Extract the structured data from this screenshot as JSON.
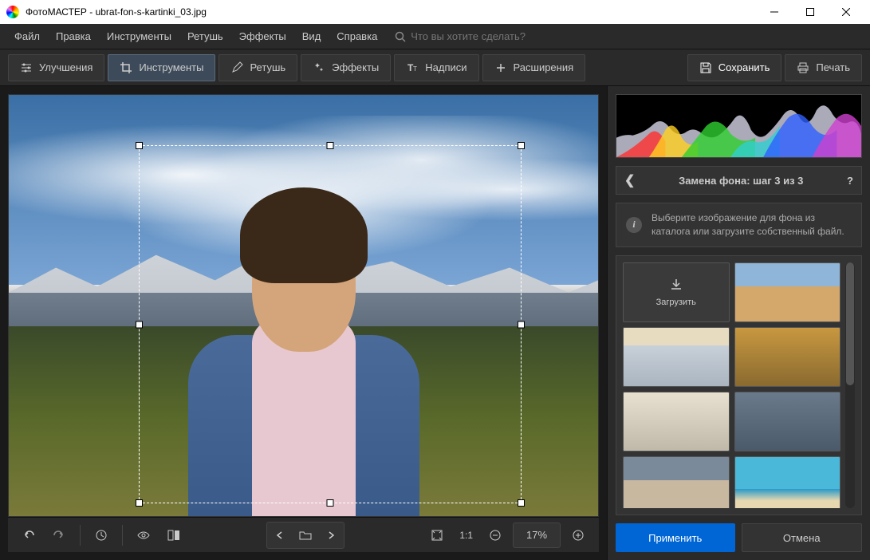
{
  "titlebar": {
    "app_name": "ФотоМАСТЕР",
    "file_name": "ubrat-fon-s-kartinki_03.jpg",
    "full_title": "ФотоМАСТЕР - ubrat-fon-s-kartinki_03.jpg"
  },
  "menubar": {
    "items": [
      "Файл",
      "Правка",
      "Инструменты",
      "Ретушь",
      "Эффекты",
      "Вид",
      "Справка"
    ],
    "search_placeholder": "Что вы хотите сделать?"
  },
  "toolbar": {
    "tabs": [
      {
        "label": "Улучшения",
        "icon": "sliders-icon",
        "active": false
      },
      {
        "label": "Инструменты",
        "icon": "crop-icon",
        "active": true
      },
      {
        "label": "Ретушь",
        "icon": "brush-icon",
        "active": false
      },
      {
        "label": "Эффекты",
        "icon": "wand-icon",
        "active": false
      },
      {
        "label": "Надписи",
        "icon": "text-icon",
        "active": false
      },
      {
        "label": "Расширения",
        "icon": "plus-icon",
        "active": false
      }
    ],
    "save_label": "Сохранить",
    "print_label": "Печать"
  },
  "bottombar": {
    "zoom_value": "17%",
    "ratio_label": "1:1"
  },
  "right_panel": {
    "header_title": "Замена фона: шаг 3 из 3",
    "info_text": "Выберите изображение для фона из каталога или загрузите собственный файл.",
    "upload_label": "Загрузить",
    "backgrounds": [
      {
        "name": "upload",
        "type": "upload"
      },
      {
        "name": "desert",
        "colors": [
          "#d4a76a",
          "#8fb5d8"
        ]
      },
      {
        "name": "winter-road",
        "colors": [
          "#c8d0d8",
          "#e8dcc0"
        ]
      },
      {
        "name": "autumn-trees",
        "colors": [
          "#c89840",
          "#8a6a30"
        ]
      },
      {
        "name": "living-room",
        "colors": [
          "#e8e0d0",
          "#c0b8a8"
        ]
      },
      {
        "name": "city-street",
        "colors": [
          "#6a7a8a",
          "#4a5a6a"
        ]
      },
      {
        "name": "european-town",
        "colors": [
          "#c8b8a0",
          "#7a8a9a"
        ]
      },
      {
        "name": "tropical-beach",
        "colors": [
          "#4ab8d8",
          "#e8d8b0"
        ]
      }
    ],
    "apply_label": "Применить",
    "cancel_label": "Отмена"
  }
}
